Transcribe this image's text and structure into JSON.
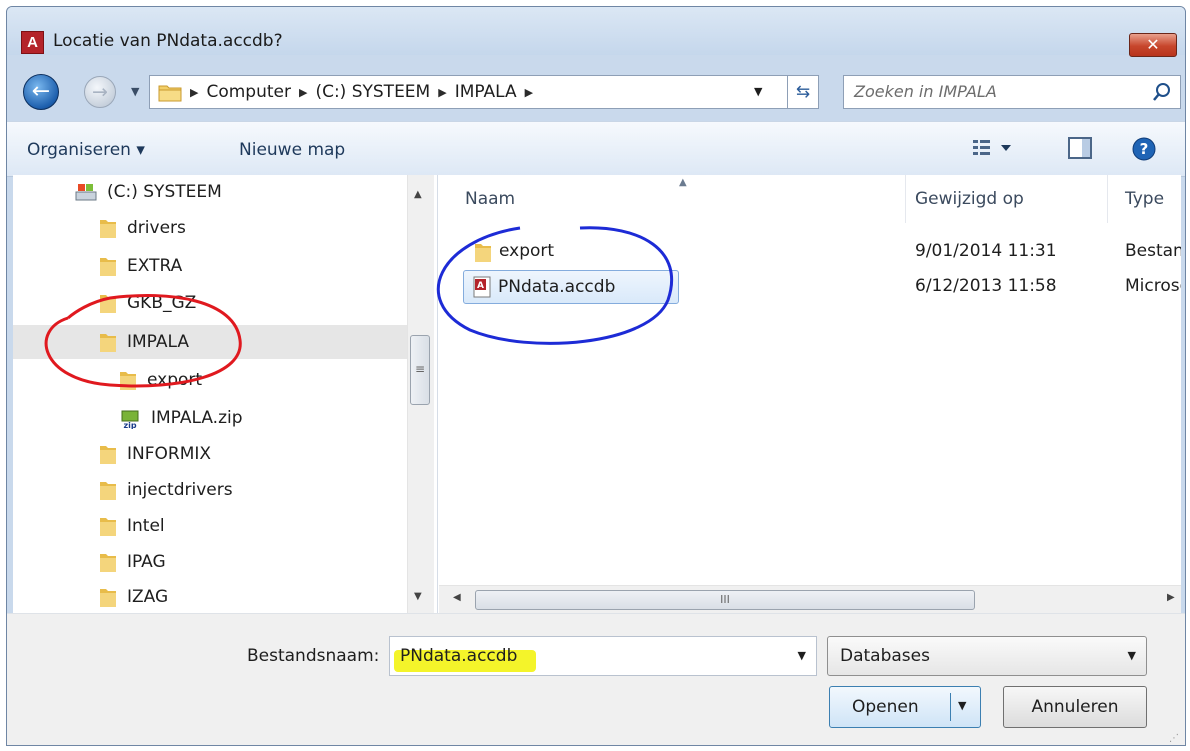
{
  "window": {
    "title": "Locatie van PNdata.accdb?",
    "app_icon_letter": "A",
    "close_glyph": "✕"
  },
  "address": {
    "crumbs": [
      "Computer",
      "(C:) SYSTEEM",
      "IMPALA"
    ],
    "search_placeholder": "Zoeken in IMPALA"
  },
  "toolbar": {
    "organize": "Organiseren ▾",
    "new_folder": "Nieuwe map"
  },
  "tree": {
    "items": [
      {
        "label": "(C:) SYSTEEM",
        "kind": "drive-icon"
      },
      {
        "label": "drivers",
        "kind": "folder-icon"
      },
      {
        "label": "EXTRA",
        "kind": "folder-icon"
      },
      {
        "label": "GKB_GZ",
        "kind": "folder-icon"
      },
      {
        "label": "IMPALA",
        "kind": "folder-icon",
        "selected": true
      },
      {
        "label": "export",
        "kind": "folder-icon"
      },
      {
        "label": "IMPALA.zip",
        "kind": "zip-icon"
      },
      {
        "label": "INFORMIX",
        "kind": "folder-icon"
      },
      {
        "label": "injectdrivers",
        "kind": "folder-icon"
      },
      {
        "label": "Intel",
        "kind": "folder-icon"
      },
      {
        "label": "IPAG",
        "kind": "folder-icon"
      },
      {
        "label": "IZAG",
        "kind": "folder-icon"
      }
    ]
  },
  "files": {
    "columns": [
      "Naam",
      "Gewijzigd op",
      "Type"
    ],
    "rows": [
      {
        "name": "export",
        "modified": "9/01/2014 11:31",
        "type": "Bestand",
        "icon": "folder-icon"
      },
      {
        "name": "PNdata.accdb",
        "modified": "6/12/2013 11:58",
        "type": "Microsc",
        "icon": "access-file-icon",
        "selected": true
      }
    ]
  },
  "scroll": {
    "thumb_grip": "≡",
    "h_thumb_grip": "III"
  },
  "bottom": {
    "filename_label": "Bestandsnaam:",
    "filename_value": "PNdata.accdb",
    "filetype_value": "Databases",
    "open_label": "Openen",
    "cancel_label": "Annuleren"
  },
  "colors": {
    "annotation_red": "#e0191f",
    "annotation_blue": "#1d2bd6",
    "highlight_yellow": "#f4f42a",
    "selection_blue": "#84acdd"
  }
}
